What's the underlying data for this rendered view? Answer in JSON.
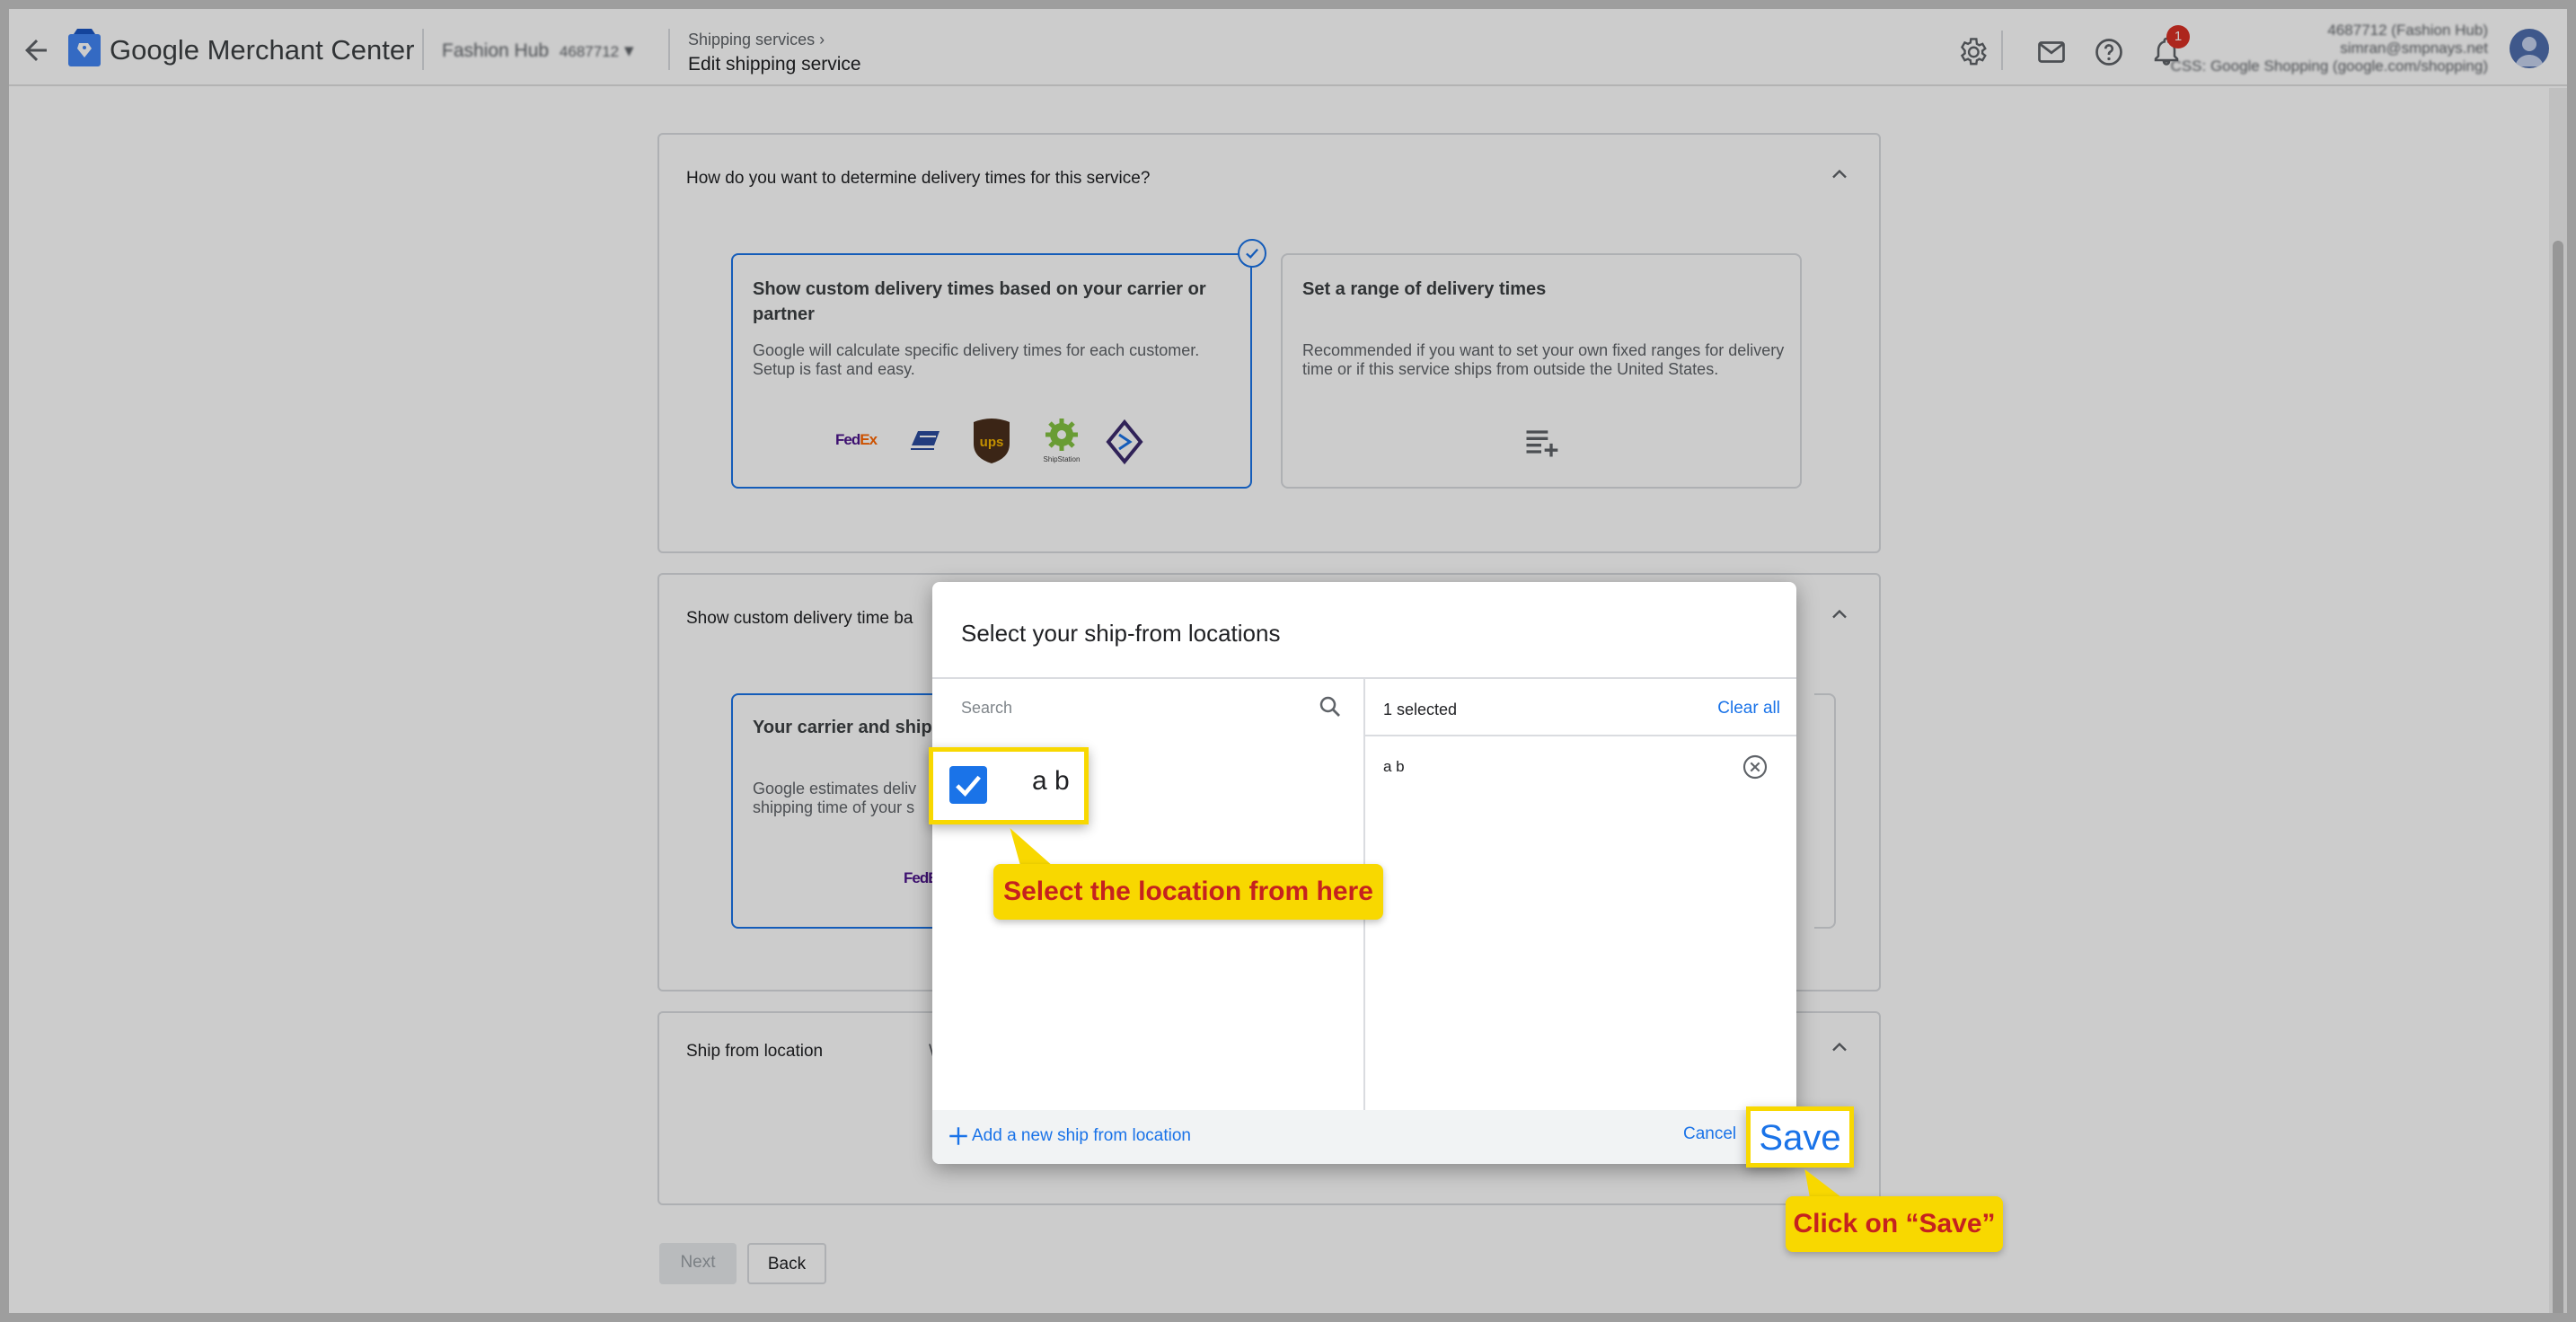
{
  "header": {
    "app_name": "Google Merchant Center",
    "account_name": "Fashion Hub",
    "account_id": "4687712",
    "breadcrumb_parent": "Shipping services",
    "page_title": "Edit shipping service",
    "notification_count": "1",
    "user_line1": "4687712 (Fashion Hub)",
    "user_line2": "simran@smpnays.net",
    "user_line3": "CSS: Google Shopping (google.com/shopping)"
  },
  "section_delivery": {
    "question": "How do you want to determine delivery times for this service?",
    "option_custom": {
      "title": "Show custom delivery times based on your carrier or partner",
      "description": "Google will calculate specific delivery times for each customer. Setup is fast and easy.",
      "carriers": [
        "FedEx",
        "USPS",
        "ups",
        "ShipStation",
        "Partner"
      ]
    },
    "option_range": {
      "title": "Set a range of delivery times",
      "description": "Recommended if you want to set your own fixed ranges for delivery time or if this service ships from outside the United States."
    }
  },
  "section_custom": {
    "title": "Show custom delivery time ba",
    "option_title": "Your carrier and ship f",
    "option_desc": "Google estimates deliv shipping time of your s",
    "carrier": "FedEx"
  },
  "section_ship": {
    "title": "Ship from location",
    "extra": "W"
  },
  "buttons": {
    "next": "Next",
    "back": "Back"
  },
  "dialog": {
    "title": "Select your ship-from locations",
    "search_placeholder": "Search",
    "selected_count": "1 selected",
    "clear_all": "Clear all",
    "selected_items": [
      "a b"
    ],
    "add_location": "Add a new ship from location",
    "cancel": "Cancel",
    "save": "Save"
  },
  "annotations": {
    "checkbox_label": "a b",
    "callout_select": "Select the location from here",
    "callout_save": "Click on “Save”"
  },
  "colors": {
    "accent": "#1a73e8",
    "highlight": "#f8d800",
    "callout_text": "#c5221f"
  }
}
